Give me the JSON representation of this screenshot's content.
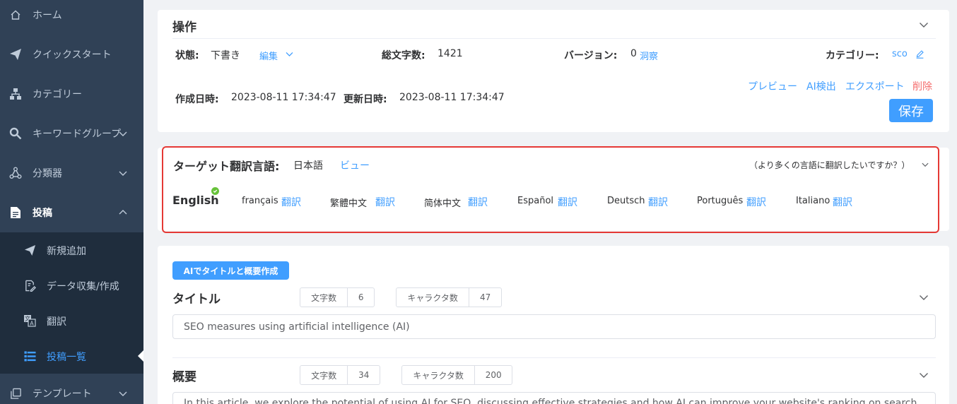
{
  "sidebar": {
    "items": [
      {
        "label": "ホーム",
        "icon": "home-icon"
      },
      {
        "label": "クイックスタート",
        "icon": "paper-plane-icon"
      },
      {
        "label": "カテゴリー",
        "icon": "sitemap-icon"
      },
      {
        "label": "キーワードグループ",
        "icon": "search-icon"
      },
      {
        "label": "分類器",
        "icon": "nodes-icon"
      },
      {
        "label": "投稿",
        "icon": "document-icon"
      },
      {
        "label": "テンプレート",
        "icon": "copy-icon"
      }
    ],
    "submenu": [
      {
        "label": "新規追加",
        "icon": "paper-plane-icon"
      },
      {
        "label": "データ収集/作成",
        "icon": "file-edit-icon"
      },
      {
        "label": "翻訳",
        "icon": "translate-icon"
      },
      {
        "label": "投稿一覧",
        "icon": "list-icon"
      }
    ]
  },
  "operations": {
    "title": "操作",
    "status_label": "状態:",
    "status_value": "下書き",
    "edit_link": "編集",
    "total_chars_label": "総文字数:",
    "total_chars_value": "1421",
    "version_label": "バージョン:",
    "version_value": "0",
    "insight_link": "洞察",
    "category_label": "カテゴリー:",
    "category_value": "sco",
    "created_label": "作成日時:",
    "created_value": "2023-08-11 17:34:47",
    "updated_label": "更新日時:",
    "updated_value": "2023-08-11 17:34:47",
    "preview_link": "プレビュー",
    "ai_detect_link": "AI検出",
    "export_link": "エクスポート",
    "delete_link": "削除",
    "save_button": "保存"
  },
  "translation": {
    "title": "ターゲット翻訳言語:",
    "language": "日本語",
    "view_link": "ビュー",
    "more_languages": "（より多くの言語に翻訳したいですか？）",
    "current": "English",
    "translate_label": "翻訳",
    "languages": [
      "français",
      "繁體中文",
      "简体中文",
      "Español",
      "Deutsch",
      "Português",
      "Italiano"
    ]
  },
  "content": {
    "ai_button": "AIでタイトルと概要作成",
    "title_label": "タイトル",
    "title_word_label": "文字数",
    "title_word_value": "6",
    "title_char_label": "キャラクタ数",
    "title_char_value": "47",
    "title_value": "SEO measures using artificial intelligence (AI)",
    "summary_label": "概要",
    "summary_word_label": "文字数",
    "summary_word_value": "34",
    "summary_char_label": "キャラクタ数",
    "summary_char_value": "200",
    "summary_value": "In this article, we explore the potential of using AI for SEO, discussing effective strategies and how AI can improve your website's ranking on search"
  },
  "colors": {
    "sidebar_bg": "#304156",
    "submenu_bg": "#1f2d3d",
    "accent": "#409eff",
    "danger": "#f56c6c",
    "highlight": "#e53935",
    "success": "#67c23a"
  }
}
